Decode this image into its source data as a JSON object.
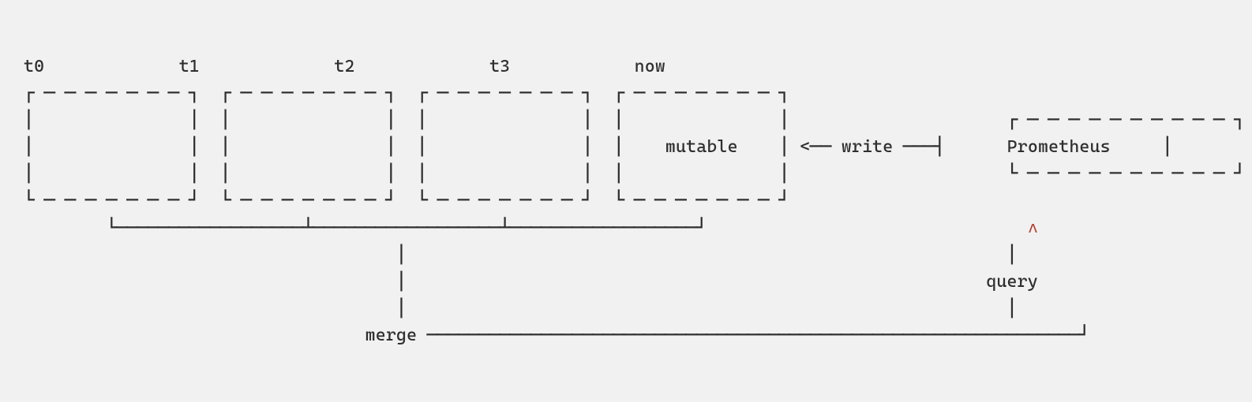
{
  "diagram": {
    "labels": {
      "t0": "t0",
      "t1": "t1",
      "t2": "t2",
      "t3": "t3",
      "now": "now",
      "mutable": "mutable",
      "write": "write",
      "prometheus": "Prometheus",
      "merge": "merge",
      "query": "query"
    },
    "ascii": {
      "box_top": "┌ ─ ─ ─ ─ ─ ─ ─ ┐",
      "box_side": "│               │",
      "box_bottom": "└ ─ ─ ─ ─ ─ ─ ─ ┘",
      "prom_top": "┌ ─ ─ ─ ─ ─ ─ ─ ─ ─ ─ ┐",
      "prom_bottom": "└ ─ ─ ─ ─ ─ ─ ─ ─ ─ ─ ┘",
      "arrow_left": "<──",
      "long_dash": "───┤",
      "brace_line": "└──────────────────┴──────────────────┴──────────────────┘",
      "brace_stem": "│",
      "caret": "∧",
      "query_corner": "───────────────────────────────────────────────────────────────┘"
    }
  }
}
